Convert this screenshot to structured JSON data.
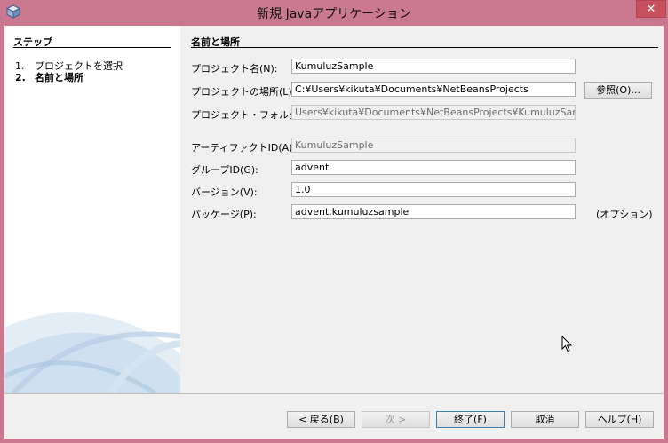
{
  "window": {
    "title": "新規 Javaアプリケーション",
    "close_label": "✕"
  },
  "steps": {
    "title": "ステップ",
    "items": [
      {
        "num": "1.",
        "label": "プロジェクトを選択"
      },
      {
        "num": "2.",
        "label": "名前と場所"
      }
    ]
  },
  "form": {
    "section_title": "名前と場所",
    "project_name": {
      "label": "プロジェクト名(N):",
      "value": "KumuluzSample"
    },
    "project_location": {
      "label": "プロジェクトの場所(L):",
      "value": "C:¥Users¥kikuta¥Documents¥NetBeansProjects"
    },
    "browse_label": "参照(O)...",
    "project_folder": {
      "label": "プロジェクト・フォルダ(D):",
      "value": "Users¥kikuta¥Documents¥NetBeansProjects¥KumuluzSample"
    },
    "artifact_id": {
      "label": "アーティファクトID(A):",
      "value": "KumuluzSample"
    },
    "group_id": {
      "label": "グループID(G):",
      "value": "advent"
    },
    "version": {
      "label": "バージョン(V):",
      "value": "1.0"
    },
    "package": {
      "label": "パッケージ(P):",
      "value": "advent.kumuluzsample"
    },
    "optional_label": "(オプション)"
  },
  "buttons": {
    "back": "< 戻る(B)",
    "next": "次 >",
    "finish": "終了(F)",
    "cancel": "取消",
    "help": "ヘルプ(H)"
  }
}
